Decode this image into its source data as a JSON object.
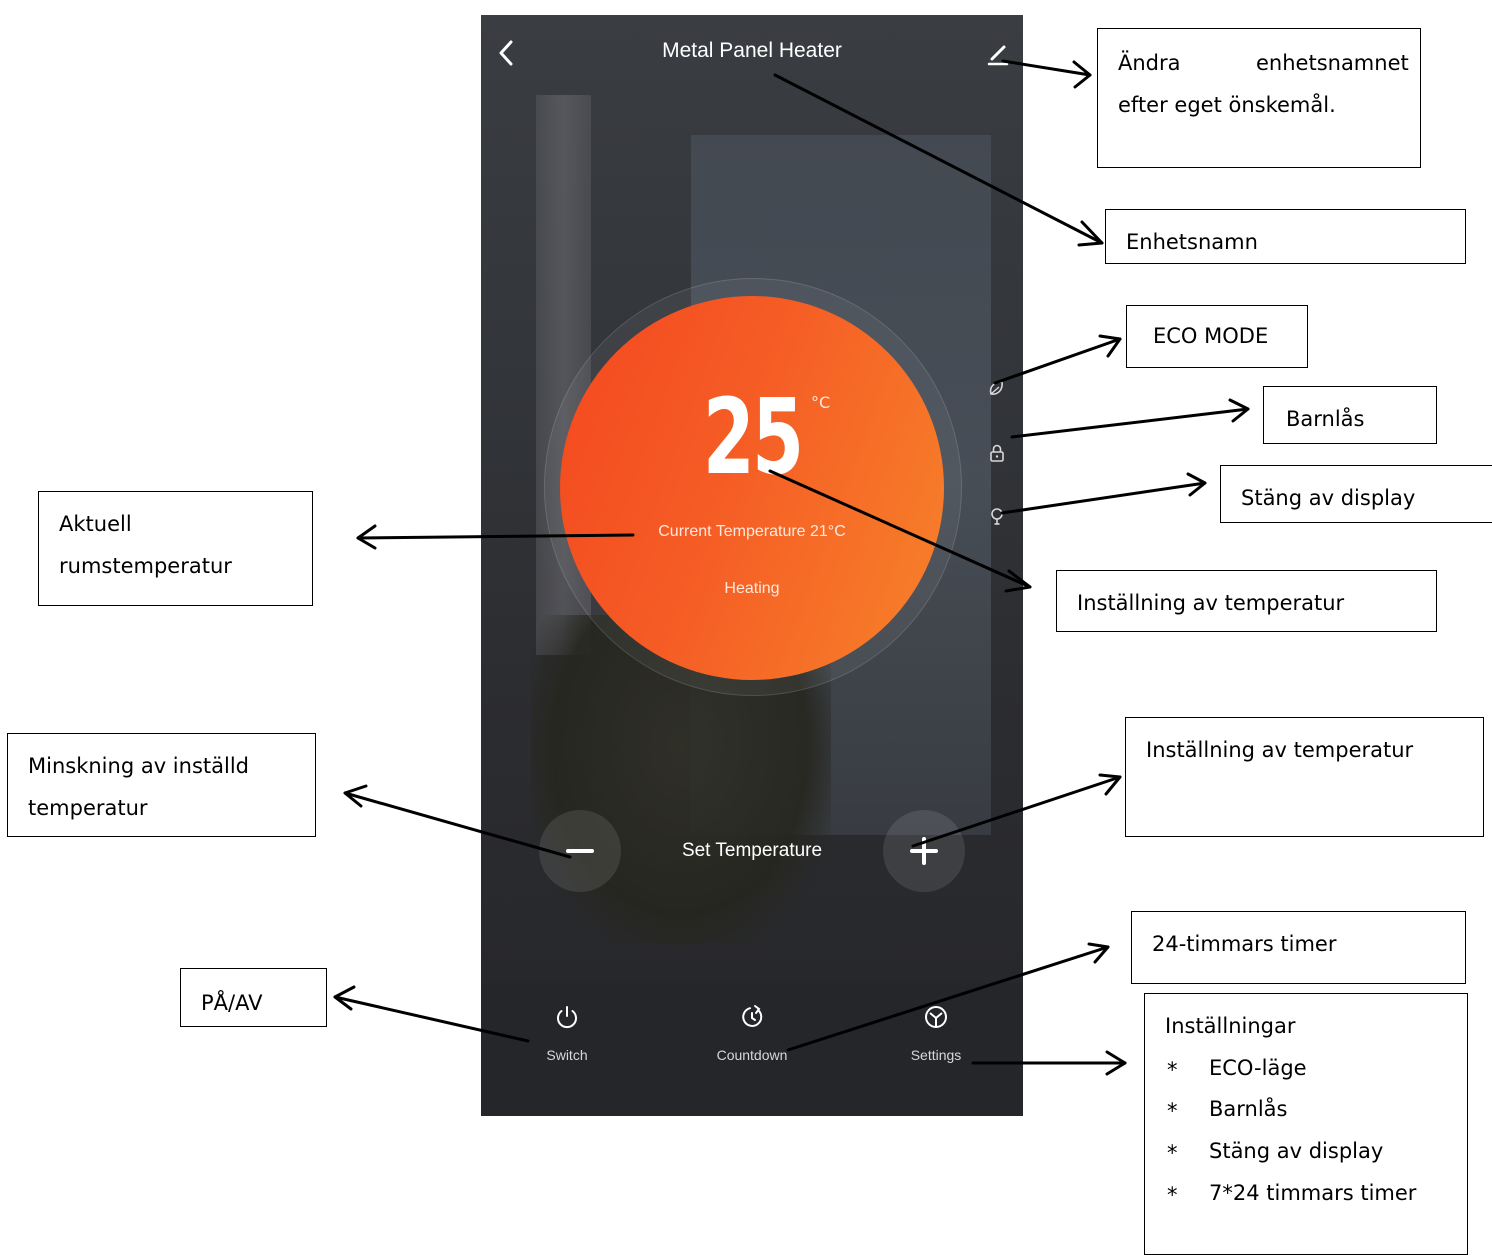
{
  "app": {
    "title": "Metal Panel Heater",
    "set_temperature_value": "25",
    "unit": "°C",
    "current_temperature": "Current Temperature 21°C",
    "mode": "Heating",
    "set_temperature_label": "Set Temperature",
    "tabs": [
      {
        "label": "Switch",
        "icon": "power-icon"
      },
      {
        "label": "Countdown",
        "icon": "countdown-icon"
      },
      {
        "label": "Settings",
        "icon": "settings-cube-icon"
      }
    ],
    "side_icons": [
      "eco-leaf-icon",
      "lock-icon",
      "bulb-icon"
    ],
    "colors": {
      "dial_start": "#f4481f",
      "dial_end": "#f7832a",
      "background": "#2c2d30"
    }
  },
  "annotations": {
    "edit_name": {
      "line1_a": "Ändra",
      "line1_b": "enhetsnamnet",
      "line2": "efter eget önskemål."
    },
    "device_name": "Enhetsnamn",
    "eco_mode": "ECO MODE",
    "child_lock": "Barnlås",
    "display_off": "Stäng av display",
    "temp_setting_1": "Inställning av temperatur",
    "current_room_temp": {
      "line1": "Aktuell",
      "line2": "rumstemperatur"
    },
    "decrease_temp": {
      "line1": "Minskning av inställd",
      "line2": "temperatur"
    },
    "temp_setting_2": "Inställning av temperatur",
    "timer_24h": "24-timmars timer",
    "on_off": "PÅ/AV",
    "settings": {
      "title": "Inställningar",
      "items": [
        "ECO-läge",
        "Barnlås",
        "Stäng av display",
        "7*24 timmars timer"
      ],
      "bullet": "*"
    }
  }
}
